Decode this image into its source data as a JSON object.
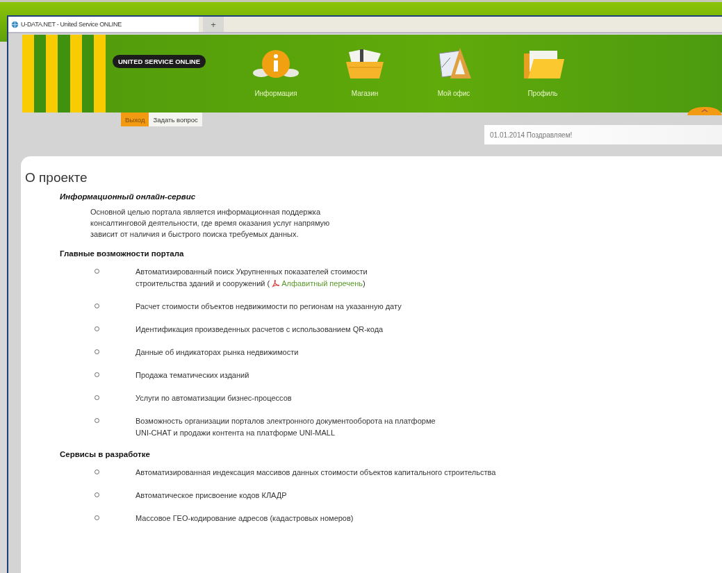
{
  "browser_tab": {
    "title": "U-DATA.NET - United Service ONLINE",
    "new_tab": "+"
  },
  "header": {
    "logo": "UNITED SERVICE ONLINE",
    "nav": [
      {
        "label": "Информация",
        "kind": "info"
      },
      {
        "label": "Магазин",
        "kind": "basket"
      },
      {
        "label": "Мой офис",
        "kind": "office"
      },
      {
        "label": "Профиль",
        "kind": "folder"
      }
    ],
    "buttons": [
      {
        "label": "Выход",
        "selected": true
      },
      {
        "label": "Задать вопрос",
        "selected": false
      }
    ],
    "news_field": {
      "value": "01.01.2014 Поздравляем!"
    }
  },
  "content": {
    "title": "О проекте",
    "sections": [
      {
        "kind": "paragraph",
        "heading": "Информационный онлайн-сервис",
        "lines": [
          "Основной целью портала является информационная поддержка",
          "консалтинговой деятельности, где время оказания услуг напрямую",
          "зависит от наличия и быстрого поиска требуемых данных."
        ]
      },
      {
        "kind": "list",
        "heading": "Главные возможности портала",
        "items": [
          {
            "lines": [
              "Автоматизированный поиск Укрупненных показателей стоимости",
              "строительства зданий и сооружений ("
            ],
            "link": "Алфавитный перечень",
            "after": ")"
          },
          {
            "lines": [
              "Расчет стоимости объектов недвижимости по регионам на указанную дату"
            ]
          },
          {
            "lines": [
              "Идентификация произведенных расчетов с использованием QR-кода"
            ]
          },
          {
            "lines": [
              "Данные об индикаторах рынка недвижимости"
            ]
          },
          {
            "lines": [
              "Продажа тематических изданий"
            ]
          },
          {
            "lines": [
              "Услуги по автоматизации бизнес-процессов"
            ]
          },
          {
            "lines": [
              "Возможность организации порталов электронного документооборота на платформе",
              "UNI-CHAT и продажи контента на платформе UNI-MALL"
            ]
          }
        ]
      },
      {
        "kind": "list",
        "heading": "Сервисы в разработке",
        "items": [
          {
            "lines": [
              "Автоматизированная индексация массивов данных стоимости объектов капитального строительства"
            ]
          },
          {
            "lines": [
              "Автоматическое присвоение кодов КЛАДР"
            ]
          },
          {
            "lines": [
              "Массовое ГЕО-кодирование адресов (кадастровых номеров)"
            ]
          }
        ]
      }
    ]
  }
}
